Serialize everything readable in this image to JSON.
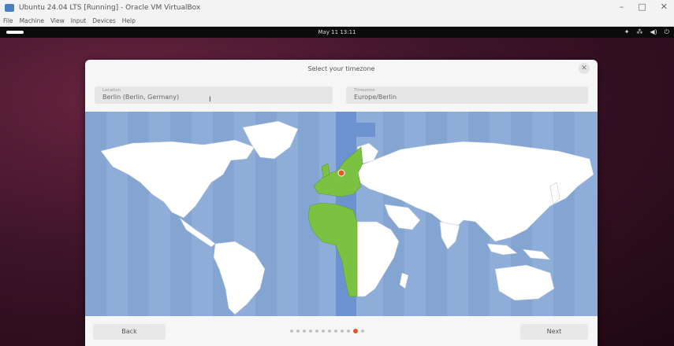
{
  "host_window": {
    "title": "Ubuntu 24.04 LTS [Running] - Oracle VM VirtualBox",
    "menu": [
      "File",
      "Machine",
      "View",
      "Input",
      "Devices",
      "Help"
    ],
    "controls": [
      "–",
      "□",
      "✕"
    ]
  },
  "guest_topbar": {
    "clock": "May 11 13:11",
    "tray": [
      "✦",
      "⁂",
      "◀)",
      "⏻"
    ]
  },
  "dialog": {
    "title": "Select your timezone",
    "close_glyph": "✕",
    "location": {
      "label": "Location",
      "value": "Berlin (Berlin, Germany)"
    },
    "timezone": {
      "label": "Timezone",
      "value": "Europe/Berlin"
    },
    "cursor_glyph": "I",
    "back_label": "Back",
    "next_label": "Next",
    "progress": {
      "total_steps": 12,
      "current_step": 11
    }
  },
  "colors": {
    "accent": "#e95420",
    "ocean": "#8eaed9",
    "land": "#ffffff",
    "selected_zone_band": "#6c93cf",
    "selected_zone_land": "#7cc242"
  },
  "icons": [
    "virtualbox-icon",
    "close-icon",
    "power-icon",
    "volume-icon",
    "network-icon"
  ]
}
